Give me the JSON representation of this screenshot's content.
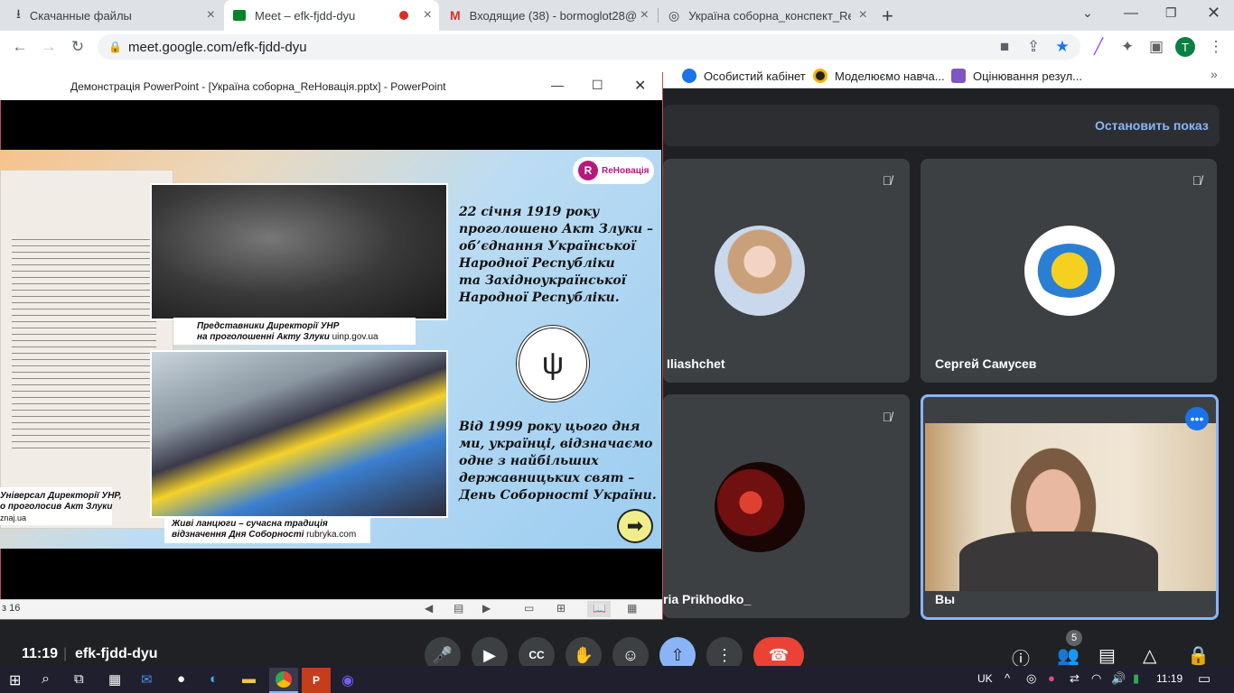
{
  "browser": {
    "tabs": [
      {
        "title": "Скачанные файлы",
        "icon": "download-icon"
      },
      {
        "title": "Meet – efk-fjdd-dyu",
        "icon": "meet-icon",
        "active": true
      },
      {
        "title": "Входящие (38) - bormoglot28@",
        "icon": "gmail-icon"
      },
      {
        "title": "Україна соборна_конспект_ReH",
        "icon": "globe-icon"
      }
    ],
    "new_tab": "+",
    "url": "meet.google.com/efk-fjdd-dyu",
    "profile_letter": "T",
    "bookmarks": [
      "Особистий кабінет",
      "Моделюємо навча...",
      "Оцінювання резул..."
    ]
  },
  "ppt": {
    "window_title": "Демонстрація PowerPoint - [Україна соборна_ReНовація.pptx] - PowerPoint",
    "status_left": "з 16",
    "slide": {
      "brand": "ReНовація",
      "heading_lines": [
        "22 січня 1919 року",
        "проголошено Акт Злуки –",
        "об’єднання Української",
        "Народної Республіки",
        "та Західноукраїнської",
        "Народної Республіки."
      ],
      "body_lines": [
        "Від 1999 року цього дня",
        "ми, українці, відзначаємо",
        "одне з найбільших",
        "державницьких свят –",
        "День Соборності України."
      ],
      "caption1_lines": [
        "Представники Директорії УНР",
        "на проголошенні Акту Злуки"
      ],
      "caption1_src": "uinp.gov.ua",
      "caption2_lines": [
        "Живі ланцюги – сучасна традиція",
        "відзначення Дня Соборності"
      ],
      "caption2_src": "rubryka.com",
      "caption3_lines": [
        "Універсал Директорії УНР,",
        "о проголосив Акт Злуки"
      ],
      "caption3_src": "znaj.ua"
    }
  },
  "meet": {
    "stop_presenting": "Остановить показ",
    "participants": [
      {
        "name": "Iliashchet",
        "muted": true
      },
      {
        "name": "Сергей Самусев",
        "muted": true
      },
      {
        "name": "ria Prikhodko_",
        "muted": true
      },
      {
        "name": "Вы",
        "muted": false
      }
    ],
    "time": "11:19",
    "meeting_code": "efk-fjdd-dyu",
    "people_count": "5"
  },
  "taskbar": {
    "lang": "UK",
    "clock": "11:19"
  },
  "colors": {
    "accent": "#8ab4f8",
    "end_call": "#ea4335",
    "present": "#8ab4f8"
  }
}
